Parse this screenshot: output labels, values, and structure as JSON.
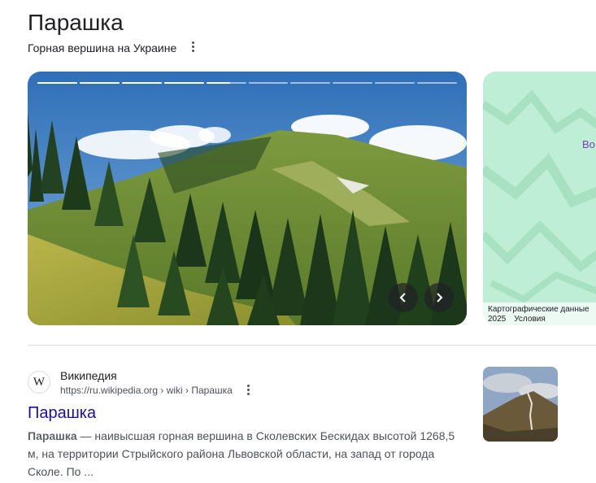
{
  "header": {
    "title": "Парашка",
    "subtitle": "Горная вершина на Украине"
  },
  "carousel": {
    "segments": [
      1,
      1,
      1,
      1,
      0.6,
      0,
      0,
      0,
      0,
      0
    ],
    "prev_icon": "chevron-left-icon",
    "next_icon": "chevron-right-icon"
  },
  "map": {
    "label": "Во",
    "attribution_line1": "Картографические данные",
    "attribution_year": "2025",
    "attribution_terms": "Условия",
    "color": "#bfeed6"
  },
  "result": {
    "site_name": "Википедия",
    "favicon": "W",
    "url": "https://ru.wikipedia.org › wiki › Парашка",
    "title": "Парашка",
    "snippet_bold": "Парашка",
    "snippet_text": " — наивысшая горная вершина в Сколевских Бескидах высотой 1268,5 м, на территории Стрыйского района Львовской области, на запад от города Сколе. По ..."
  },
  "colors": {
    "link": "#1a0dab",
    "text": "#202124",
    "muted": "#4d5156"
  }
}
